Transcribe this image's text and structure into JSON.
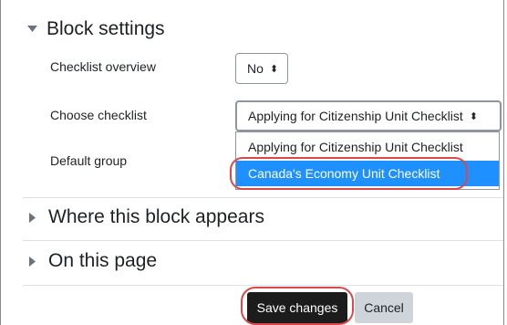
{
  "block_settings": {
    "title": "Block settings",
    "checklist_overview": {
      "label": "Checklist overview",
      "value": "No"
    },
    "choose_checklist": {
      "label": "Choose checklist",
      "value": "Applying for Citizenship Unit Checklist",
      "options": [
        "Applying for Citizenship Unit Checklist",
        "Canada's Economy Unit Checklist"
      ],
      "highlighted_option": "Canada's Economy Unit Checklist"
    },
    "default_group": {
      "label": "Default group"
    }
  },
  "sections": {
    "where_block_appears": "Where this block appears",
    "on_this_page": "On this page"
  },
  "buttons": {
    "save": "Save changes",
    "cancel": "Cancel"
  },
  "colors": {
    "highlight": "#1e90ff",
    "annotation_ring": "#d94949",
    "primary_button": "#1c1c1c"
  },
  "icons": {
    "expanded_section": "caret-down-icon",
    "collapsed_section": "caret-right-icon",
    "select_arrows": "sort-arrows-icon"
  }
}
